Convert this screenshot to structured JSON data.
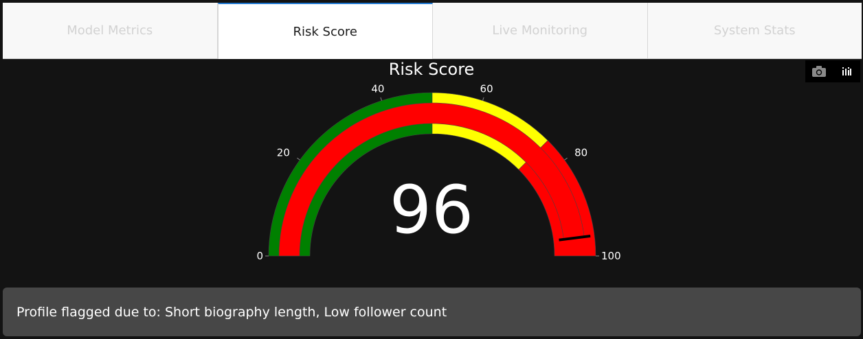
{
  "tabs": [
    {
      "label": "Model Metrics",
      "active": false
    },
    {
      "label": "Risk Score",
      "active": true
    },
    {
      "label": "Live Monitoring",
      "active": false
    },
    {
      "label": "System Stats",
      "active": false
    }
  ],
  "gauge": {
    "title": "Risk Score",
    "value": 96,
    "display_value": "96",
    "range": [
      0,
      100
    ],
    "ticks": [
      0,
      20,
      40,
      60,
      80,
      100
    ],
    "tick_labels": [
      "0",
      "20",
      "40",
      "60",
      "80",
      "100"
    ],
    "steps": [
      {
        "range": [
          0,
          50
        ],
        "color": "#008000"
      },
      {
        "range": [
          50,
          75
        ],
        "color": "#ffff00"
      },
      {
        "range": [
          75,
          100
        ],
        "color": "#ff0000"
      }
    ],
    "bar_color": "#ff0000",
    "threshold": 96,
    "threshold_color": "#000000"
  },
  "modebar": {
    "camera_icon": "camera-icon",
    "plotly_icon": "plotly-logo-icon"
  },
  "flag_message": "Profile flagged due to: Short biography length, Low follower count"
}
